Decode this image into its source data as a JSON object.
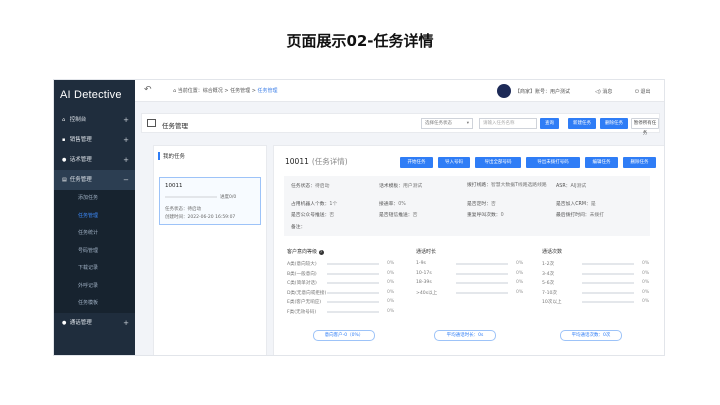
{
  "slide_title": "页面展示02-任务详情",
  "app": {
    "logo": "AI Detective",
    "sidebar": {
      "items": [
        {
          "label": "控制台",
          "sign": "+"
        },
        {
          "label": "销售管理",
          "sign": "+"
        },
        {
          "label": "话术管理",
          "sign": "+"
        },
        {
          "label": "任务管理",
          "sign": "−"
        }
      ],
      "sub_items": [
        "添加任务",
        "任务管理",
        "任务统计",
        "号码管理",
        "下载记录",
        "外呼记录",
        "任务模板"
      ],
      "bottom_item": {
        "label": "通话管理",
        "sign": "+"
      }
    },
    "topbar": {
      "back_icon": "↶",
      "breadcrumb_prefix": "当前位置：综合概况 > 任务管理 > ",
      "breadcrumb_current": "任务管理",
      "avatar_text": "avatar",
      "user": "【商家】账号：用户测试",
      "messages": "消息",
      "logout": "退出"
    },
    "header": {
      "title": "任务管理",
      "status_select": "选择任务状态",
      "search_placeholder": "请输入任务名称",
      "search_btn": "查询",
      "new_task_btn": "新建任务",
      "delete_task_btn": "删除任务",
      "pause_all_btn": "暂停所有任务"
    },
    "left_panel": {
      "title": "我的任务",
      "task": {
        "name": "10011",
        "progress_label": "进度0/0",
        "status": "任务状态：待启动",
        "created": "创建时间：2022-06-20 16:59:07"
      }
    },
    "detail": {
      "task_id": "10011",
      "subtitle": "(任务详情)",
      "buttons": [
        "开始任务",
        "导入号码",
        "导出全部号码",
        "导出未拨打号码",
        "编辑任务",
        "删除任务"
      ],
      "info": [
        {
          "label": "任务状态：",
          "value": "待启动"
        },
        {
          "label": "话术模板：",
          "value": "用户测试"
        },
        {
          "label": "拨打线路：",
          "value": "智慧大数据T线路选路线路"
        },
        {
          "label": "ASR：",
          "value": "AIJ测试"
        },
        {
          "label": "占用机器人个数：",
          "value": "1个"
        },
        {
          "label": "接通率：",
          "value": "0%"
        },
        {
          "label": "是否定时：",
          "value": "否"
        },
        {
          "label": "是否加入CRM：",
          "value": "是"
        },
        {
          "label": "是否公众号推送：",
          "value": "否"
        },
        {
          "label": "是否短信推送：",
          "value": "否"
        },
        {
          "label": "重复呼叫次数：",
          "value": "0"
        },
        {
          "label": "最后拨打时间：",
          "value": "未拨打"
        },
        {
          "label": "备注：",
          "value": ""
        }
      ],
      "stats": [
        {
          "heading": "客户意向等级",
          "rows": [
            {
              "label": "A类(意向较大)",
              "pct": "0%"
            },
            {
              "label": "B类(一般意向)",
              "pct": "0%"
            },
            {
              "label": "C类(简单对话)",
              "pct": "0%"
            },
            {
              "label": "D类(无意向或拒接)",
              "pct": "0%"
            },
            {
              "label": "E类(客户无响应)",
              "pct": "0%"
            },
            {
              "label": "F类(无效号码)",
              "pct": "0%"
            }
          ],
          "button": "意向客户-0（0%）"
        },
        {
          "heading": "通话时长",
          "rows": [
            {
              "label": "1-9s",
              "pct": "0%"
            },
            {
              "label": "10-17s",
              "pct": "0%"
            },
            {
              "label": "18-39s",
              "pct": "0%"
            },
            {
              "label": ">40s以上",
              "pct": "0%"
            }
          ],
          "button": "平均通话时长：0s"
        },
        {
          "heading": "通话次数",
          "rows": [
            {
              "label": "1-2次",
              "pct": "0%"
            },
            {
              "label": "3-4次",
              "pct": "0%"
            },
            {
              "label": "5-6次",
              "pct": "0%"
            },
            {
              "label": "7-10次",
              "pct": "0%"
            },
            {
              "label": "10次以上",
              "pct": "0%"
            }
          ],
          "button": "平均通话次数：0次"
        }
      ]
    }
  }
}
